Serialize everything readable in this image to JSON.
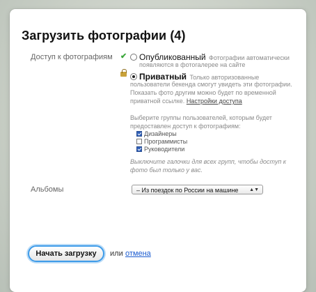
{
  "dialog": {
    "title": "Загрузить фотографии (4)",
    "access": {
      "label": "Доступ к фотографиям",
      "options": [
        {
          "title": "Опубликованный",
          "desc_line1": "Фотографии автоматически",
          "desc_line2": "появляются в фотогалерее на сайте",
          "selected": false
        },
        {
          "title": "Приватный",
          "desc_line1": "Только авторизованные",
          "desc_line2": "пользователи бекенда смогут увидеть эти фотографии.",
          "desc_line3": "Показать фото другим можно будет по временной",
          "desc_line4": "приватной ссылке.",
          "link": "Настройки доступа",
          "selected": true
        }
      ],
      "groups_intro_line1": "Выберите группы пользователей, которым будет",
      "groups_intro_line2": "предоставлен доступ к фотографиям:",
      "groups": [
        {
          "label": "Дизайнеры",
          "checked": true
        },
        {
          "label": "Программисты",
          "checked": false
        },
        {
          "label": "Руководители",
          "checked": true
        }
      ],
      "hint_line1": "Выключите галочки для всех групп, чтобы доступ к",
      "hint_line2": "фото был только у вас."
    },
    "albums": {
      "label": "Альбомы",
      "selected": "– Из поездок по России на машине"
    },
    "actions": {
      "start": "Начать загрузку",
      "or": "или",
      "cancel": "отмена"
    },
    "colors": {
      "accent": "#3d9be9",
      "link": "#1a5bd0",
      "check_green": "#3aa63a"
    }
  }
}
